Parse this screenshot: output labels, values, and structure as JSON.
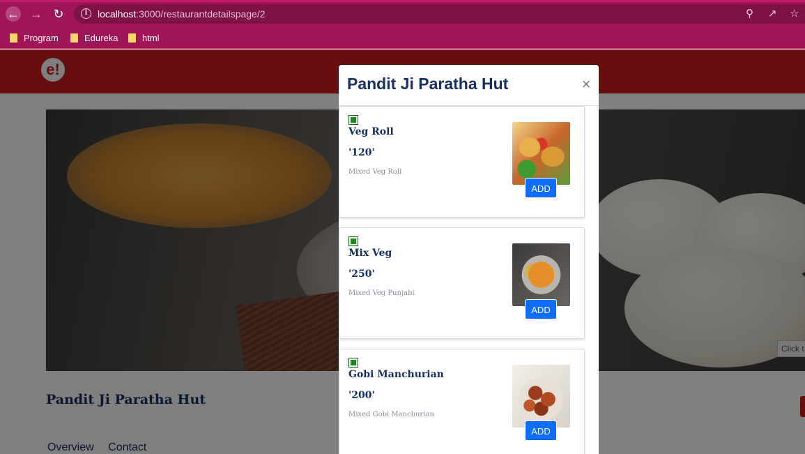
{
  "browser": {
    "url_host": "localhost",
    "url_rest": ":3000/restaurantdetailspage/2",
    "bookmarks": [
      {
        "label": "Program"
      },
      {
        "label": "Edureka"
      },
      {
        "label": "html"
      }
    ]
  },
  "site": {
    "logo_text": "e!",
    "restaurant_name": "Pandit Ji Paratha Hut",
    "tabs": [
      {
        "label": "Overview"
      },
      {
        "label": "Contact"
      }
    ],
    "tooltip_text": "Click t"
  },
  "modal": {
    "title": "Pandit Ji Paratha Hut",
    "close_symbol": "×",
    "items": [
      {
        "name": "Veg Roll",
        "price": "'120'",
        "description": "Mixed Veg Roll",
        "add_label": "ADD",
        "image": "veg-roll-photo"
      },
      {
        "name": "Mix Veg",
        "price": "'250'",
        "description": "Mixed Veg Punjabi",
        "add_label": "ADD",
        "image": "mix-veg-photo"
      },
      {
        "name": "Gobi Manchurian",
        "price": "'200'",
        "description": "Mixed Gobi Manchurian",
        "add_label": "ADD",
        "image": "gobi-manchurian-photo"
      }
    ]
  },
  "colors": {
    "browser_chrome": "#a01458",
    "site_header": "#ce1f1f",
    "title_navy": "#192f60",
    "add_button": "#0d6efd",
    "veg_green": "#1a8a1a"
  }
}
